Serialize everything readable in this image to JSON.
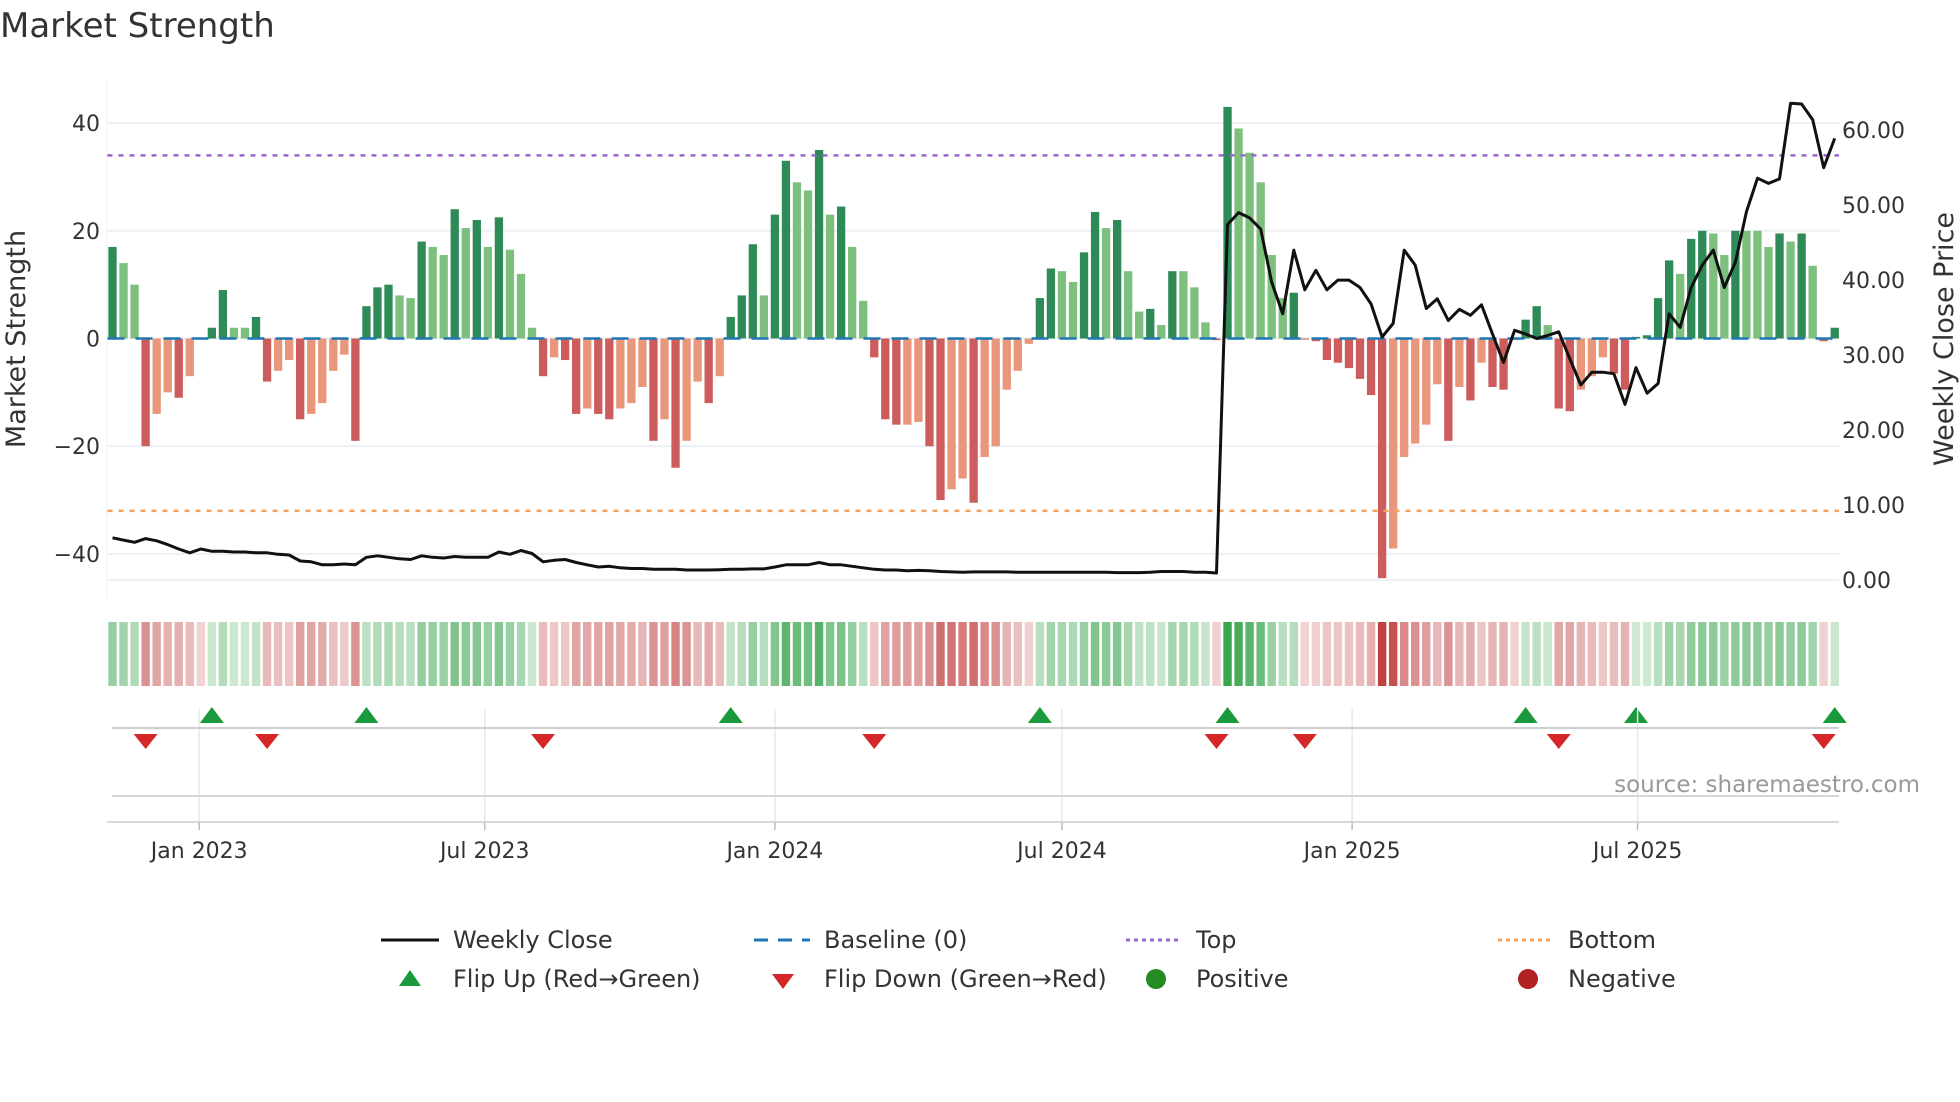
{
  "title": "Market Strength",
  "source": "source: sharemaestro.com",
  "colors": {
    "pos_strong": "#2e8b57",
    "pos_weak": "#7dbf7d",
    "neg_strong": "#cd5c5c",
    "neg_weak": "#e9967a",
    "baseline": "#1f77b4",
    "top": "#9966cc",
    "bottom": "#f4a460",
    "close": "#111111",
    "flip_up": "#1a9a3c",
    "flip_down": "#d62728",
    "positive": "#228b22",
    "negative": "#b22222"
  },
  "legend": [
    {
      "label": "Weekly Close",
      "icon": "solid-line"
    },
    {
      "label": "Baseline (0)",
      "icon": "dashed-line"
    },
    {
      "label": "Top",
      "icon": "dotted-line"
    },
    {
      "label": "Bottom",
      "icon": "dotted-line"
    },
    {
      "label": "Flip Up (Red→Green)",
      "icon": "triangle-up"
    },
    {
      "label": "Flip Down (Green→Red)",
      "icon": "triangle-down"
    },
    {
      "label": "Positive",
      "icon": "circle"
    },
    {
      "label": "Negative",
      "icon": "circle"
    }
  ],
  "chart_data": {
    "type": "bar",
    "title": "Market Strength",
    "ylabel": "Market Strength",
    "y2label": "Weekly Close Price",
    "frequency": "weekly",
    "start_date": "2022-11-07",
    "ylim": [
      -48,
      48
    ],
    "y2lim": [
      -2.3,
      66.7
    ],
    "yticks": [
      {
        "v": 40,
        "label": "40"
      },
      {
        "v": 20,
        "label": "20"
      },
      {
        "v": 0,
        "label": "0"
      },
      {
        "v": -20,
        "label": "−20"
      },
      {
        "v": -40,
        "label": "−40"
      }
    ],
    "y2ticks": [
      {
        "v": 60,
        "label": "60.00"
      },
      {
        "v": 50,
        "label": "50.00"
      },
      {
        "v": 40,
        "label": "40.00"
      },
      {
        "v": 30,
        "label": "30.00"
      },
      {
        "v": 20,
        "label": "20.00"
      },
      {
        "v": 10,
        "label": "10.00"
      },
      {
        "v": 0,
        "label": "0.00"
      }
    ],
    "xticks": [
      {
        "date": "2023-01-01",
        "label": "Jan 2023"
      },
      {
        "date": "2023-07-01",
        "label": "Jul 2023"
      },
      {
        "date": "2024-01-01",
        "label": "Jan 2024"
      },
      {
        "date": "2024-07-01",
        "label": "Jul 2024"
      },
      {
        "date": "2025-01-01",
        "label": "Jan 2025"
      },
      {
        "date": "2025-07-01",
        "label": "Jul 2025"
      }
    ],
    "top_level": 34,
    "bottom_level": -32,
    "baseline": 0,
    "strength": [
      17,
      14,
      10,
      -20,
      -14,
      -10,
      -11,
      -7,
      -0.2,
      2,
      9,
      2,
      2,
      4,
      -8,
      -6,
      -4,
      -15,
      -14,
      -12,
      -6,
      -3,
      -19,
      6,
      9.5,
      10,
      8,
      7.5,
      18,
      17,
      15.5,
      24,
      20.5,
      22,
      17,
      22.5,
      16.5,
      12,
      2,
      -7,
      -3.5,
      -4,
      -14,
      -13,
      -14,
      -15,
      -13,
      -12,
      -9,
      -19,
      -15,
      -24,
      -19,
      -8,
      -12,
      -7,
      4,
      8,
      17.5,
      8,
      23,
      33,
      29,
      27.5,
      35,
      23,
      24.5,
      17,
      7,
      -3.5,
      -15,
      -16,
      -16,
      -15.5,
      -20,
      -30,
      -28,
      -26,
      -30.5,
      -22,
      -20,
      -9.5,
      -6,
      -1,
      7.5,
      13,
      12.5,
      10.5,
      16,
      23.5,
      20.5,
      22,
      12.5,
      5,
      5.5,
      2.5,
      12.5,
      12.5,
      9.5,
      3,
      -0.3,
      43,
      39,
      34.5,
      29,
      15.5,
      7.5,
      8.5,
      -0.2,
      -0.5,
      -4,
      -4.5,
      -5.5,
      -7.5,
      -10.5,
      -44.5,
      -39,
      -22,
      -19.5,
      -16,
      -8.5,
      -19,
      -9,
      -11.5,
      -4.5,
      -9,
      -9.5,
      -0.3,
      3.5,
      6,
      2.5,
      -13,
      -13.5,
      -9.5,
      -7,
      -3.5,
      -6.5,
      -9.5,
      0.3,
      0.6,
      7.5,
      14.5,
      12,
      18.5,
      20,
      19.5,
      15.5,
      20,
      20,
      20,
      17,
      19.5,
      18,
      19.5,
      13.5,
      -0.5,
      2
    ],
    "weekly_close": [
      5.6,
      5.3,
      5.0,
      5.5,
      5.2,
      4.7,
      4.1,
      3.6,
      4.1,
      3.8,
      3.8,
      3.7,
      3.7,
      3.6,
      3.6,
      3.4,
      3.3,
      2.5,
      2.4,
      2.0,
      2.0,
      2.1,
      2.0,
      3.0,
      3.2,
      3.0,
      2.8,
      2.7,
      3.2,
      3.0,
      2.9,
      3.1,
      3.0,
      3.0,
      3.0,
      3.7,
      3.4,
      3.9,
      3.5,
      2.4,
      2.6,
      2.7,
      2.3,
      2.0,
      1.7,
      1.8,
      1.6,
      1.5,
      1.5,
      1.4,
      1.4,
      1.4,
      1.3,
      1.3,
      1.3,
      1.35,
      1.4,
      1.4,
      1.45,
      1.45,
      1.7,
      2.0,
      2.0,
      2.0,
      2.3,
      2.0,
      2.0,
      1.8,
      1.6,
      1.4,
      1.3,
      1.3,
      1.2,
      1.25,
      1.2,
      1.1,
      1.05,
      1.0,
      1.05,
      1.05,
      1.05,
      1.05,
      1.0,
      1.0,
      1.0,
      1.0,
      1.0,
      1.0,
      1.0,
      1.0,
      1.0,
      0.95,
      0.95,
      0.95,
      1.0,
      1.1,
      1.1,
      1.1,
      1.0,
      1.0,
      0.9,
      47.4,
      49,
      48.3,
      46.8,
      39.7,
      35.5,
      44,
      38.7,
      41.3,
      38.7,
      40,
      40,
      39,
      36.8,
      32.4,
      34.2,
      44,
      42,
      36.2,
      37.5,
      34.6,
      36.1,
      35.3,
      36.7,
      32.8,
      29,
      33.3,
      32.8,
      32.2,
      32.6,
      33.1,
      29.5,
      26,
      27.7,
      27.7,
      27.5,
      23.4,
      28.3,
      24.9,
      26.2,
      35.5,
      33.7,
      39,
      42,
      44,
      39,
      42.4,
      49.1,
      53.6,
      52.9,
      53.5,
      63.6,
      63.5,
      61.4,
      55,
      58.9
    ]
  }
}
